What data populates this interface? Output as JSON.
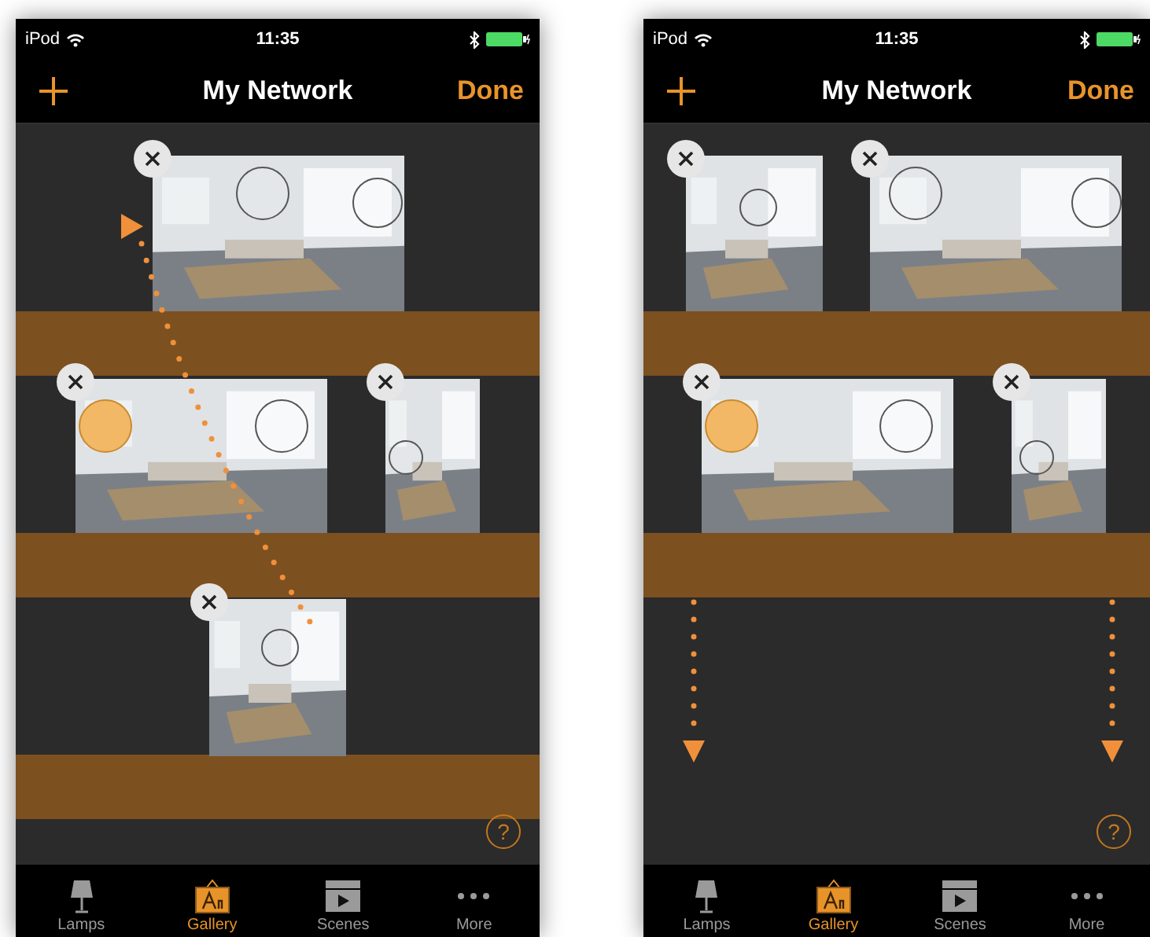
{
  "phones": [
    {
      "status_bar": {
        "carrier": "iPod",
        "time": "11:35"
      },
      "nav_bar": {
        "title": "My Network",
        "done": "Done"
      },
      "help": "?",
      "tabs": [
        {
          "label": "Lamps",
          "selected": false
        },
        {
          "label": "Gallery",
          "selected": true
        },
        {
          "label": "Scenes",
          "selected": false
        },
        {
          "label": "More",
          "selected": false
        }
      ]
    },
    {
      "status_bar": {
        "carrier": "iPod",
        "time": "11:35"
      },
      "nav_bar": {
        "title": "My Network",
        "done": "Done"
      },
      "help": "?",
      "tabs": [
        {
          "label": "Lamps",
          "selected": false
        },
        {
          "label": "Gallery",
          "selected": true
        },
        {
          "label": "Scenes",
          "selected": false
        },
        {
          "label": "More",
          "selected": false
        }
      ]
    }
  ]
}
